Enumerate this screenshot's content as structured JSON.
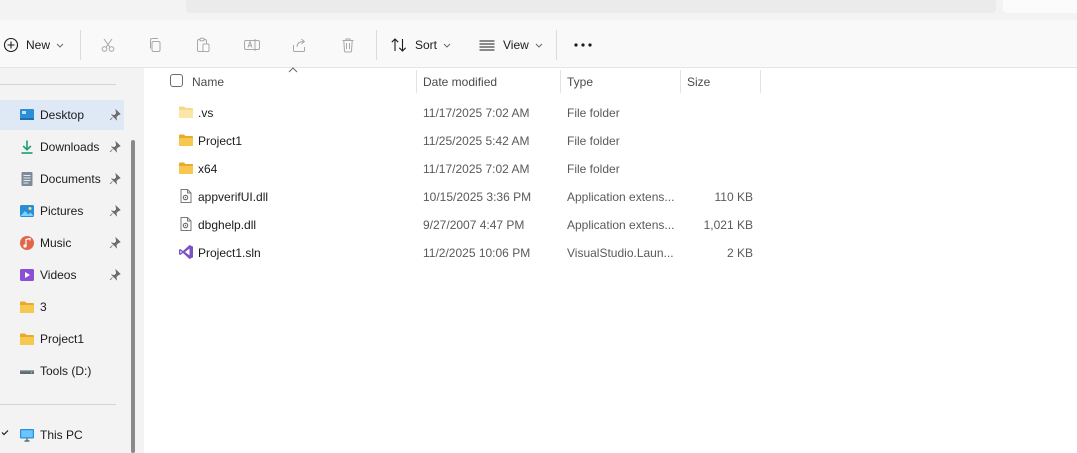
{
  "toolbar": {
    "new_label": "New",
    "sort_label": "Sort",
    "view_label": "View",
    "icons": [
      "plus-circle-icon",
      "cut-icon",
      "copy-icon",
      "paste-icon",
      "rename-icon",
      "share-icon",
      "delete-icon",
      "sort-icon",
      "view-icon",
      "more-icon"
    ]
  },
  "sidebar": {
    "items": [
      {
        "label": "Desktop",
        "icon": "desktop-icon",
        "pinned": true,
        "selected": true
      },
      {
        "label": "Downloads",
        "icon": "download-icon",
        "pinned": true
      },
      {
        "label": "Documents",
        "icon": "documents-icon",
        "pinned": true
      },
      {
        "label": "Pictures",
        "icon": "pictures-icon",
        "pinned": true
      },
      {
        "label": "Music",
        "icon": "music-icon",
        "pinned": true
      },
      {
        "label": "Videos",
        "icon": "videos-icon",
        "pinned": true
      },
      {
        "label": "3",
        "icon": "folder-icon"
      },
      {
        "label": "Project1",
        "icon": "folder-icon"
      },
      {
        "label": "Tools (D:)",
        "icon": "drive-icon"
      }
    ],
    "this_pc": {
      "label": "This PC",
      "icon": "monitor-icon"
    }
  },
  "columns": {
    "name": "Name",
    "date": "Date modified",
    "type": "Type",
    "size": "Size"
  },
  "files": [
    {
      "name": ".vs",
      "date": "11/17/2025 7:02 AM",
      "type": "File folder",
      "size": "",
      "icon": "folder-light-icon"
    },
    {
      "name": "Project1",
      "date": "11/25/2025 5:42 AM",
      "type": "File folder",
      "size": "",
      "icon": "folder-icon"
    },
    {
      "name": "x64",
      "date": "11/17/2025 7:02 AM",
      "type": "File folder",
      "size": "",
      "icon": "folder-icon"
    },
    {
      "name": "appverifUI.dll",
      "date": "10/15/2025 3:36 PM",
      "type": "Application extens...",
      "size": "110 KB",
      "icon": "dll-file-icon"
    },
    {
      "name": "dbghelp.dll",
      "date": "9/27/2007 4:47 PM",
      "type": "Application extens...",
      "size": "1,021 KB",
      "icon": "dll-file-icon"
    },
    {
      "name": "Project1.sln",
      "date": "11/2/2025 10:06 PM",
      "type": "VisualStudio.Laun...",
      "size": "2 KB",
      "icon": "visual-studio-icon"
    }
  ],
  "colors": {
    "accent": "#0067c0",
    "folder": "#f4c24a",
    "selected_bg": "#dfe9f5",
    "vs_purple": "#7b52c4"
  }
}
